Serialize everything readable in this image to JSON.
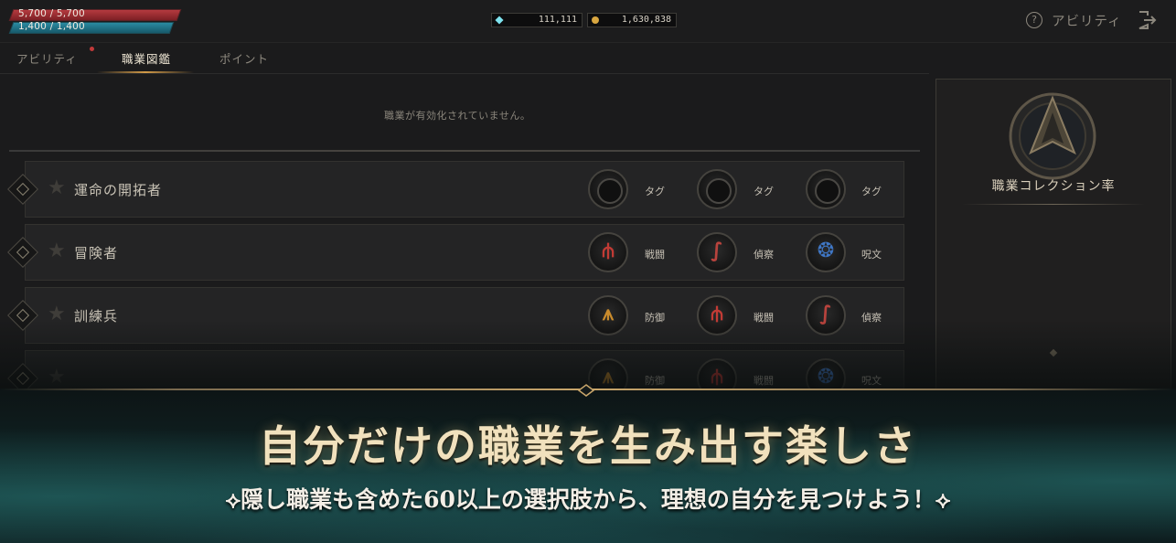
{
  "hud": {
    "hp_text": "5,700 / 5,700",
    "hp_fraction": 1.0,
    "mp_text": "1,400 / 1,400",
    "mp_fraction": 1.0
  },
  "currency": {
    "gems": "111,111",
    "gold": "1,630,838",
    "gem_icon": "gem-icon",
    "gold_icon": "gold-coin-icon"
  },
  "header": {
    "help_icon": "question-circle-icon",
    "ability_label": "アビリティ",
    "exit_icon": "exit-icon"
  },
  "tabs": [
    {
      "label": "アビリティ",
      "has_badge": true
    },
    {
      "label": "職業図鑑",
      "active": true
    },
    {
      "label": "ポイント"
    }
  ],
  "main": {
    "status": "職業が有効化されていません。"
  },
  "jobs": [
    {
      "name": "運命の開拓者",
      "tags": [
        {
          "type": "empty",
          "label": "タグ"
        },
        {
          "type": "empty",
          "label": "タグ"
        },
        {
          "type": "empty",
          "label": "タグ"
        }
      ]
    },
    {
      "name": "冒険者",
      "tags": [
        {
          "type": "combat",
          "label": "戦闘"
        },
        {
          "type": "scout",
          "label": "偵察"
        },
        {
          "type": "spell",
          "label": "呪文"
        }
      ]
    },
    {
      "name": "訓練兵",
      "tags": [
        {
          "type": "defense",
          "label": "防御"
        },
        {
          "type": "combat",
          "label": "戦闘"
        },
        {
          "type": "scout",
          "label": "偵察"
        }
      ]
    },
    {
      "name": "",
      "tags": [
        {
          "type": "defense",
          "label": "防御"
        },
        {
          "type": "combat",
          "label": "戦闘"
        },
        {
          "type": "spell",
          "label": "呪文"
        }
      ]
    }
  ],
  "side": {
    "title": "職業コレクション率",
    "emblem_icon": "class-crest-icon"
  },
  "promo": {
    "headline": "自分だけの職業を生み出す楽しさ",
    "subline": "⟡隠し職業も含めた60以上の選択肢から、理想の自分を見つけよう！⟡"
  },
  "colors": {
    "hp": "#b53a3f",
    "mp": "#2a8aa1",
    "accent": "#d39b48",
    "teal": "#1e5a5c"
  }
}
